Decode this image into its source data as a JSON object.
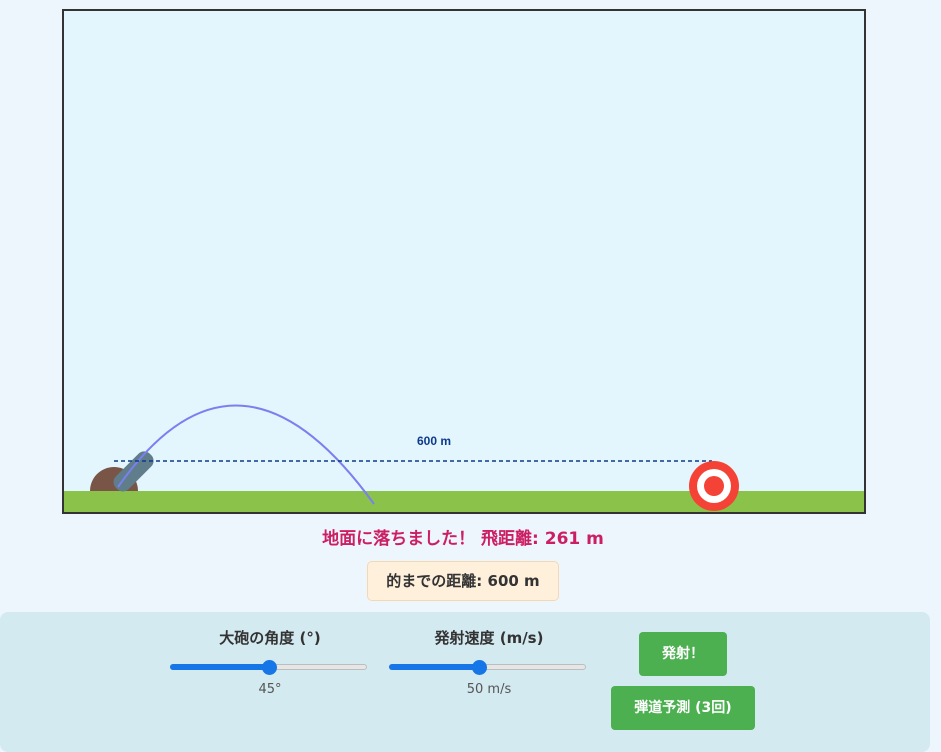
{
  "scene": {
    "target_distance_label": "600 m",
    "sky_color": "#e3f5fd",
    "ground_color": "#8bc34a",
    "cannon_color": "#607d8b",
    "cannon_base_color": "#795548",
    "target_colors": [
      "#f44336",
      "#ffffff"
    ],
    "trajectory_color": "#7b7ff0"
  },
  "status": {
    "message": "地面に落ちました！ 飛距離: 261 m"
  },
  "info": {
    "distance_to_target": "的までの距離: 600 m"
  },
  "controls": {
    "angle": {
      "label": "大砲の角度 (°)",
      "value": 45,
      "min": 0,
      "max": 90,
      "display": "45°"
    },
    "speed": {
      "label": "発射速度 (m/s)",
      "value": 50,
      "min": 0,
      "max": 110,
      "display": "50 m/s"
    },
    "fire_button": "発射！",
    "predict_button": "弾道予測 (3回)"
  }
}
